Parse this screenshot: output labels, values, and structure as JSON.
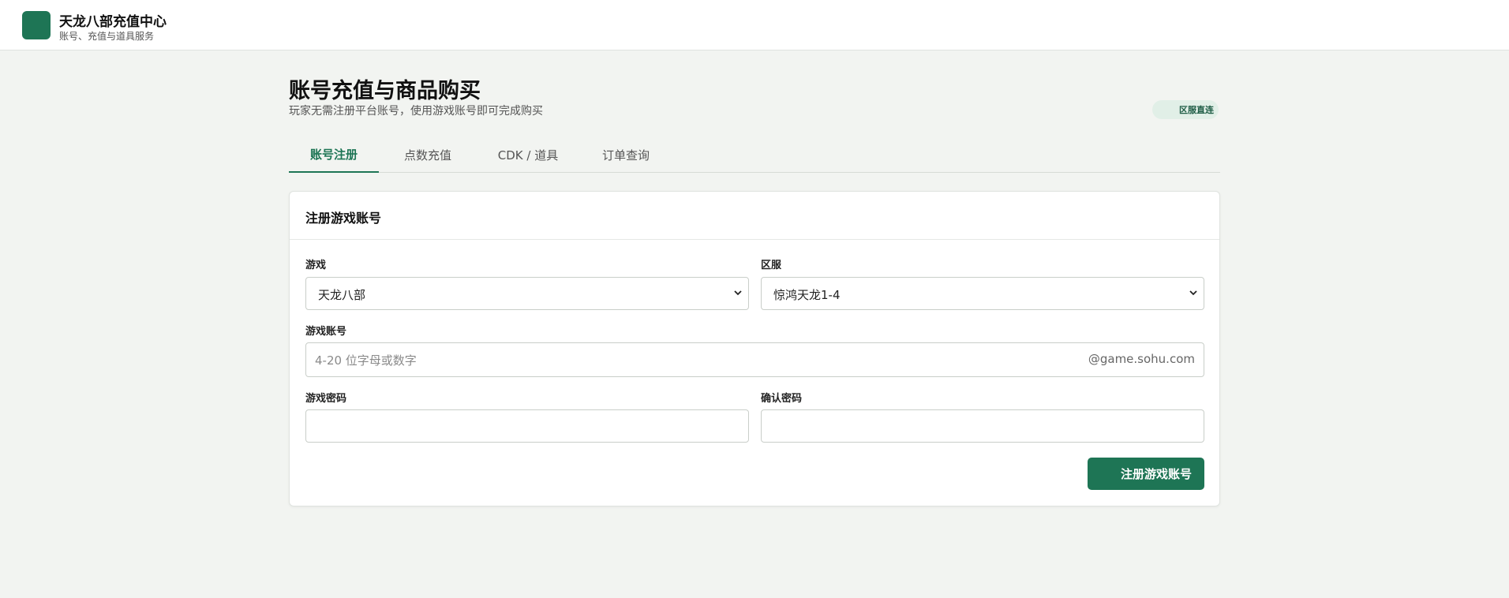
{
  "brand": {
    "title": "天龙八部充值中心",
    "subtitle": "账号、充值与道具服务"
  },
  "page": {
    "title": "账号充值与商品购买",
    "subtitle": "玩家无需注册平台账号，使用游戏账号即可完成购买",
    "badge": "区服直连"
  },
  "tabs": [
    {
      "label": "账号注册",
      "active": true
    },
    {
      "label": "点数充值",
      "active": false
    },
    {
      "label": "CDK / 道具",
      "active": false
    },
    {
      "label": "订单查询",
      "active": false
    }
  ],
  "form": {
    "title": "注册游戏账号",
    "game_label": "游戏",
    "game_value": "天龙八部",
    "server_label": "区服",
    "server_value": "惊鸿天龙1-4",
    "account_label": "游戏账号",
    "account_placeholder": "4-20 位字母或数字",
    "account_suffix": "@game.sohu.com",
    "password_label": "游戏密码",
    "confirm_label": "确认密码",
    "submit_label": "注册游戏账号"
  },
  "colors": {
    "accent": "#1e7555",
    "background": "#f2f4f1",
    "badge_bg": "#e1efe7"
  }
}
